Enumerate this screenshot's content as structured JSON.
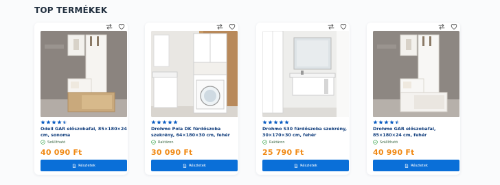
{
  "section": {
    "title": "TOP TERMÉKEK"
  },
  "products": [
    {
      "name": "Odell GAR előszobafal, 85×180×24 cm, sonoma",
      "rating": 4.5,
      "stock": "Szállítható",
      "price": "40 090 Ft",
      "button_label": "Részletek",
      "image_icon": "hallway-wardrobe-image"
    },
    {
      "name": "Drohmo Pola DK fürdőszoba szekrény, 64×180×30 cm, fehér",
      "rating": 5,
      "stock": "Raktáron",
      "price": "30 090 Ft",
      "button_label": "Részletek",
      "image_icon": "bathroom-cabinet-image"
    },
    {
      "name": "Drohmo S30 fürdőszoba szekrény, 30×170×30 cm, fehér",
      "rating": 5,
      "stock": "Raktáron",
      "price": "25 790 Ft",
      "button_label": "Részletek",
      "image_icon": "bathroom-cabinet-image"
    },
    {
      "name": "Drohmo GAR előszobafal, 85×180×24 cm, fehér",
      "rating": 4.5,
      "stock": "Szállítható",
      "price": "40 990 Ft",
      "button_label": "Részletek",
      "image_icon": "hallway-wardrobe-image"
    }
  ],
  "icons": {
    "compare": "compare-arrows-icon",
    "wishlist": "heart-icon",
    "star": "star-icon",
    "stock": "check-circle-icon",
    "button": "document-icon"
  },
  "colors": {
    "price": "#f08a16",
    "button": "#0a6fd8",
    "star": "#0a5cc2",
    "name": "#0c3a7a",
    "stock_ok": "#2ea043"
  }
}
